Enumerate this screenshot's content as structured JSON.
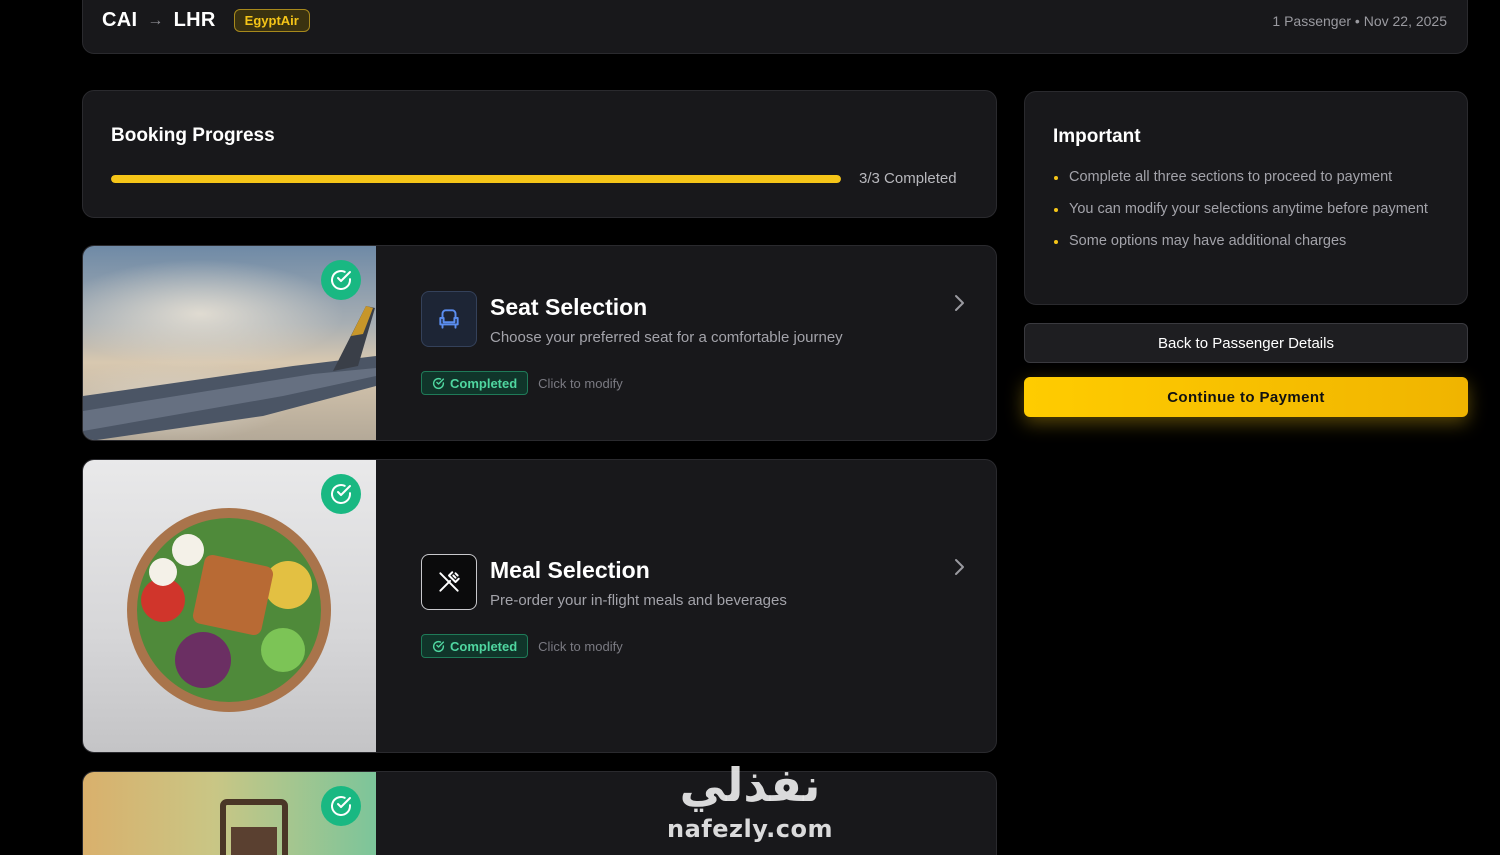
{
  "header": {
    "origin": "CAI",
    "arrow": "→",
    "destination": "LHR",
    "airline": "EgyptAir",
    "trip_meta": "1 Passenger • Nov 22, 2025"
  },
  "progress": {
    "title": "Booking Progress",
    "count_label": "3/3 Completed",
    "fraction": 1.0
  },
  "options": [
    {
      "title": "Seat Selection",
      "description": "Choose your preferred seat for a comfortable journey",
      "status": "Completed",
      "hint": "Click to modify"
    },
    {
      "title": "Meal Selection",
      "description": "Pre-order your in-flight meals and beverages",
      "status": "Completed",
      "hint": "Click to modify"
    }
  ],
  "important": {
    "title": "Important",
    "items": [
      "Complete all three sections to proceed to payment",
      "You can modify your selections anytime before payment",
      "Some options may have additional charges"
    ]
  },
  "buttons": {
    "back": "Back to Passenger Details",
    "continue": "Continue to Payment"
  },
  "watermark": {
    "arabic": "نفذلي",
    "latin": "nafezly.com"
  },
  "colors": {
    "accent": "#f5c518",
    "success": "#19b882",
    "background": "#000000",
    "card": "#18181b"
  }
}
